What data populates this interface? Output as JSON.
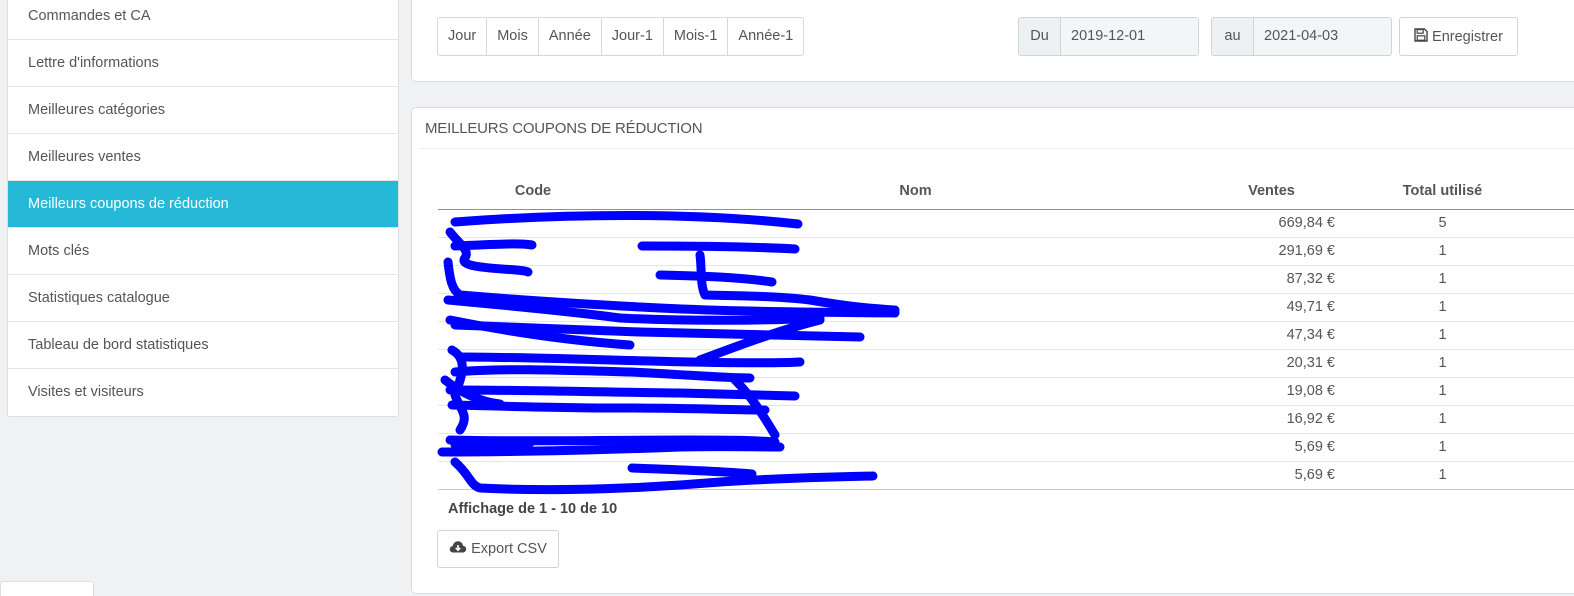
{
  "sidebar": {
    "items": [
      {
        "label": "Commandes et CA"
      },
      {
        "label": "Lettre d'informations"
      },
      {
        "label": "Meilleures catégories"
      },
      {
        "label": "Meilleures ventes"
      },
      {
        "label": "Meilleurs coupons de réduction",
        "active": true
      },
      {
        "label": "Mots clés"
      },
      {
        "label": "Statistiques catalogue"
      },
      {
        "label": "Tableau de bord statistiques"
      },
      {
        "label": "Visites et visiteurs"
      }
    ]
  },
  "toolbar": {
    "periods": [
      "Jour",
      "Mois",
      "Année",
      "Jour-1",
      "Mois-1",
      "Année-1"
    ],
    "from_label": "Du",
    "from_value": "2019-12-01",
    "to_label": "au",
    "to_value": "2021-04-03",
    "save_label": "Enregistrer",
    "save_icon": "floppy-disk-icon"
  },
  "coupons": {
    "heading": "MEILLEURS COUPONS DE RÉDUCTION",
    "columns": {
      "code": "Code",
      "nom": "Nom",
      "ventes": "Ventes",
      "total": "Total utilisé"
    },
    "rows": [
      {
        "code": "",
        "nom": "",
        "ventes": "669,84 €",
        "total": "5"
      },
      {
        "code": "",
        "nom": "",
        "ventes": "291,69 €",
        "total": "1"
      },
      {
        "code": "",
        "nom": "",
        "ventes": "87,32 €",
        "total": "1"
      },
      {
        "code": "",
        "nom": "",
        "ventes": "49,71 €",
        "total": "1"
      },
      {
        "code": "",
        "nom": "",
        "ventes": "47,34 €",
        "total": "1"
      },
      {
        "code": "",
        "nom": "",
        "ventes": "20,31 €",
        "total": "1"
      },
      {
        "code": "",
        "nom": "",
        "ventes": "19,08 €",
        "total": "1"
      },
      {
        "code": "",
        "nom": "",
        "ventes": "16,92 €",
        "total": "1"
      },
      {
        "code": "",
        "nom": "",
        "ventes": "5,69 €",
        "total": "1"
      },
      {
        "code": "",
        "nom": "",
        "ventes": "5,69 €",
        "total": "1"
      }
    ],
    "summary": "Affichage de 1 - 10 de 10",
    "export_label": "Export CSV",
    "export_icon": "cloud-download-icon"
  },
  "colors": {
    "accent": "#25b9d7",
    "redaction": "#0000ff"
  }
}
